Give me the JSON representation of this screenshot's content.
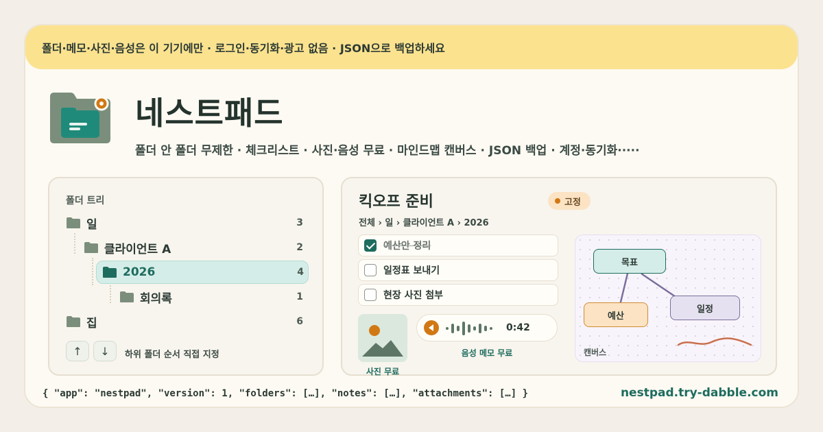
{
  "banner": {
    "text": "폴더·메모·사진·음성은 이 기기에만 · 로그인·동기화·광고 없음 · JSON으로 백업하세요"
  },
  "app": {
    "title": "네스트패드",
    "tagline": "폴더 안 폴더 무제한 · 체크리스트 · 사진·음성 무료 · 마인드맵 캔버스 · JSON 백업 · 계정·동기화·····",
    "domain": "nestpad.try-dabble.com"
  },
  "tree": {
    "title": "폴더 트리",
    "items": [
      {
        "label": "일",
        "count": "3"
      },
      {
        "label": "클라이언트 A",
        "count": "2"
      },
      {
        "label": "2026",
        "count": "4"
      },
      {
        "label": "회의록",
        "count": "1"
      },
      {
        "label": "집",
        "count": "6"
      }
    ],
    "up_icon": "arrow-up",
    "down_icon": "arrow-down",
    "up_symbol": "↑",
    "down_symbol": "↓",
    "reorder_hint": "하위 폴더 순서 직접 지정"
  },
  "note": {
    "title": "킥오프 준비",
    "pin_label": "고정",
    "breadcrumb": "전체 › 일 › 클라이언트 A › 2026",
    "checklist": [
      {
        "label": "예산안 정리",
        "checked": true
      },
      {
        "label": "일정표 보내기",
        "checked": false
      },
      {
        "label": "현장 사진 첨부",
        "checked": false
      }
    ],
    "photo_label": "사진 무료",
    "audio_time": "0:42",
    "audio_label": "음성 메모 무료",
    "canvas": {
      "label": "캔버스",
      "nodes": [
        "목표",
        "예산",
        "일정"
      ]
    }
  },
  "footer": {
    "json_preview": "{ \"app\": \"nestpad\", \"version\": 1, \"folders\": […], \"notes\": […], \"attachments\": […] }"
  },
  "colors": {
    "accent": "#1d6c5e",
    "banner": "#fbe28f",
    "pin": "#d17814",
    "folder": "#7b8e7c"
  }
}
